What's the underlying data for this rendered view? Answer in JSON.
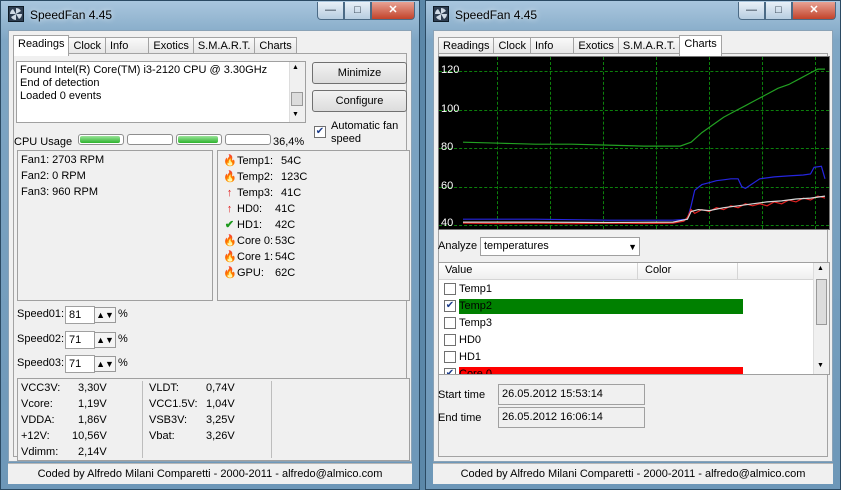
{
  "left_window": {
    "title": "SpeedFan 4.45",
    "tabs": [
      "Readings",
      "Clock",
      "Info",
      "Exotics",
      "S.M.A.R.T.",
      "Charts"
    ],
    "log_lines": [
      "Found Intel(R) Core(TM) i3-2120 CPU @ 3.30GHz",
      "End of detection",
      "Loaded 0 events"
    ],
    "minimize_label": "Minimize",
    "configure_label": "Configure",
    "auto_fan_label_1": "Automatic fan",
    "auto_fan_label_2": "speed",
    "auto_fan_checked": true,
    "cpu_usage_label": "CPU Usage",
    "cpu_usage_percent": "36,4%",
    "cpu_cores_usage": [
      0.95,
      0.0,
      0.95,
      0.0
    ],
    "fans": [
      "Fan1: 2703 RPM",
      "Fan2: 0 RPM",
      "Fan3: 960 RPM"
    ],
    "temps": [
      {
        "name": "Temp1:",
        "value": "54C",
        "icon": "fire-icon"
      },
      {
        "name": "Temp2:",
        "value": "123C",
        "icon": "fire-icon"
      },
      {
        "name": "Temp3:",
        "value": "41C",
        "icon": "up-arrow-icon"
      },
      {
        "name": "HD0:",
        "value": "41C",
        "icon": "up-arrow-icon"
      },
      {
        "name": "HD1:",
        "value": "42C",
        "icon": "check-icon"
      },
      {
        "name": "Core 0:",
        "value": "53C",
        "icon": "fire-icon"
      },
      {
        "name": "Core 1:",
        "value": "54C",
        "icon": "fire-icon"
      },
      {
        "name": "GPU:",
        "value": "62C",
        "icon": "fire-icon"
      }
    ],
    "speeds": [
      {
        "label": "Speed01:",
        "value": "81",
        "unit": "%"
      },
      {
        "label": "Speed02:",
        "value": "71",
        "unit": "%"
      },
      {
        "label": "Speed03:",
        "value": "71",
        "unit": "%"
      }
    ],
    "voltages_left": [
      {
        "name": "VCC3V:",
        "value": "3,30V"
      },
      {
        "name": "Vcore:",
        "value": "1,19V"
      },
      {
        "name": "VDDA:",
        "value": "1,86V"
      },
      {
        "name": "+12V:",
        "value": "10,56V"
      },
      {
        "name": "Vdimm:",
        "value": "2,14V"
      }
    ],
    "voltages_right": [
      {
        "name": "VLDT:",
        "value": "0,74V"
      },
      {
        "name": "VCC1.5V:",
        "value": "1,04V"
      },
      {
        "name": "VSB3V:",
        "value": "3,25V"
      },
      {
        "name": "Vbat:",
        "value": "3,26V"
      }
    ],
    "status": "Coded by Alfredo Milani Comparetti - 2000-2011 - alfredo@almico.com"
  },
  "right_window": {
    "title": "SpeedFan 4.45",
    "tabs": [
      "Readings",
      "Clock",
      "Info",
      "Exotics",
      "S.M.A.R.T.",
      "Charts"
    ],
    "analyze_label": "Analyze",
    "analyze_value": "temperatures",
    "list_headers": [
      "Value",
      "Color"
    ],
    "list_rows": [
      {
        "label": "Temp1",
        "checked": false,
        "color": ""
      },
      {
        "label": "Temp2",
        "checked": true,
        "color": "#008000"
      },
      {
        "label": "Temp3",
        "checked": false,
        "color": ""
      },
      {
        "label": "HD0",
        "checked": false,
        "color": ""
      },
      {
        "label": "HD1",
        "checked": false,
        "color": ""
      },
      {
        "label": "Core 0",
        "checked": true,
        "color": "#ff0000"
      }
    ],
    "start_time_label": "Start time",
    "start_time_value": "26.05.2012 15:53:14",
    "end_time_label": "End time",
    "end_time_value": "26.05.2012 16:06:14",
    "status": "Coded by Alfredo Milani Comparetti - 2000-2011 - alfredo@almico.com"
  },
  "chart_data": {
    "type": "line",
    "y_ticks": [
      "120",
      "100",
      "80",
      "60",
      "40"
    ],
    "ylim": [
      40,
      124
    ],
    "grid": true,
    "background": "#000000",
    "series": [
      {
        "color": "#22a022",
        "points": [
          [
            0,
            83
          ],
          [
            10,
            82.5
          ],
          [
            20,
            82
          ],
          [
            30,
            82
          ],
          [
            40,
            81.5
          ],
          [
            50,
            81
          ],
          [
            55,
            81
          ],
          [
            60,
            81
          ],
          [
            63,
            83
          ],
          [
            66,
            88
          ],
          [
            69,
            92
          ],
          [
            72,
            96
          ],
          [
            75,
            99
          ],
          [
            78,
            102
          ],
          [
            81,
            105
          ],
          [
            84,
            108
          ],
          [
            87,
            111
          ],
          [
            90,
            113
          ],
          [
            93,
            116
          ],
          [
            96,
            119
          ],
          [
            98,
            121
          ],
          [
            100,
            121
          ]
        ]
      },
      {
        "color": "#2525e0",
        "points": [
          [
            0,
            43
          ],
          [
            20,
            43
          ],
          [
            40,
            42.5
          ],
          [
            58,
            42.5
          ],
          [
            62,
            43
          ],
          [
            63,
            50
          ],
          [
            64,
            58
          ],
          [
            66,
            61
          ],
          [
            68,
            62
          ],
          [
            70,
            63
          ],
          [
            72,
            63.5
          ],
          [
            74,
            64
          ],
          [
            76,
            64
          ],
          [
            77,
            60
          ],
          [
            78,
            59
          ],
          [
            82,
            64
          ],
          [
            86,
            65
          ],
          [
            90,
            65.5
          ],
          [
            94,
            66
          ],
          [
            96,
            66.5
          ],
          [
            97,
            70
          ],
          [
            99,
            70.5
          ],
          [
            100,
            64
          ]
        ]
      },
      {
        "color": "#e02020",
        "points": [
          [
            0,
            41
          ],
          [
            10,
            40.8
          ],
          [
            20,
            41
          ],
          [
            30,
            40.7
          ],
          [
            40,
            41
          ],
          [
            50,
            40.8
          ],
          [
            58,
            41
          ],
          [
            61,
            42
          ],
          [
            62,
            44
          ],
          [
            63,
            48
          ],
          [
            64,
            46
          ],
          [
            65,
            47
          ],
          [
            66,
            48
          ],
          [
            68,
            47
          ],
          [
            70,
            49
          ],
          [
            72,
            48
          ],
          [
            74,
            50
          ],
          [
            76,
            49
          ],
          [
            78,
            51
          ],
          [
            80,
            50
          ],
          [
            82,
            51
          ],
          [
            84,
            50
          ],
          [
            86,
            52
          ],
          [
            88,
            51
          ],
          [
            90,
            53
          ],
          [
            92,
            52
          ],
          [
            94,
            54
          ],
          [
            96,
            53
          ],
          [
            98,
            55
          ],
          [
            100,
            54
          ]
        ]
      },
      {
        "color": "#d8d8d8",
        "points": [
          [
            0,
            41.5
          ],
          [
            20,
            41.5
          ],
          [
            40,
            41.3
          ],
          [
            58,
            41.5
          ],
          [
            62,
            43
          ],
          [
            63,
            47
          ],
          [
            65,
            48
          ],
          [
            68,
            47.5
          ],
          [
            72,
            49
          ],
          [
            76,
            50
          ],
          [
            80,
            51
          ],
          [
            84,
            52
          ],
          [
            88,
            52.5
          ],
          [
            92,
            53.5
          ],
          [
            96,
            54
          ],
          [
            100,
            55
          ]
        ]
      }
    ]
  }
}
